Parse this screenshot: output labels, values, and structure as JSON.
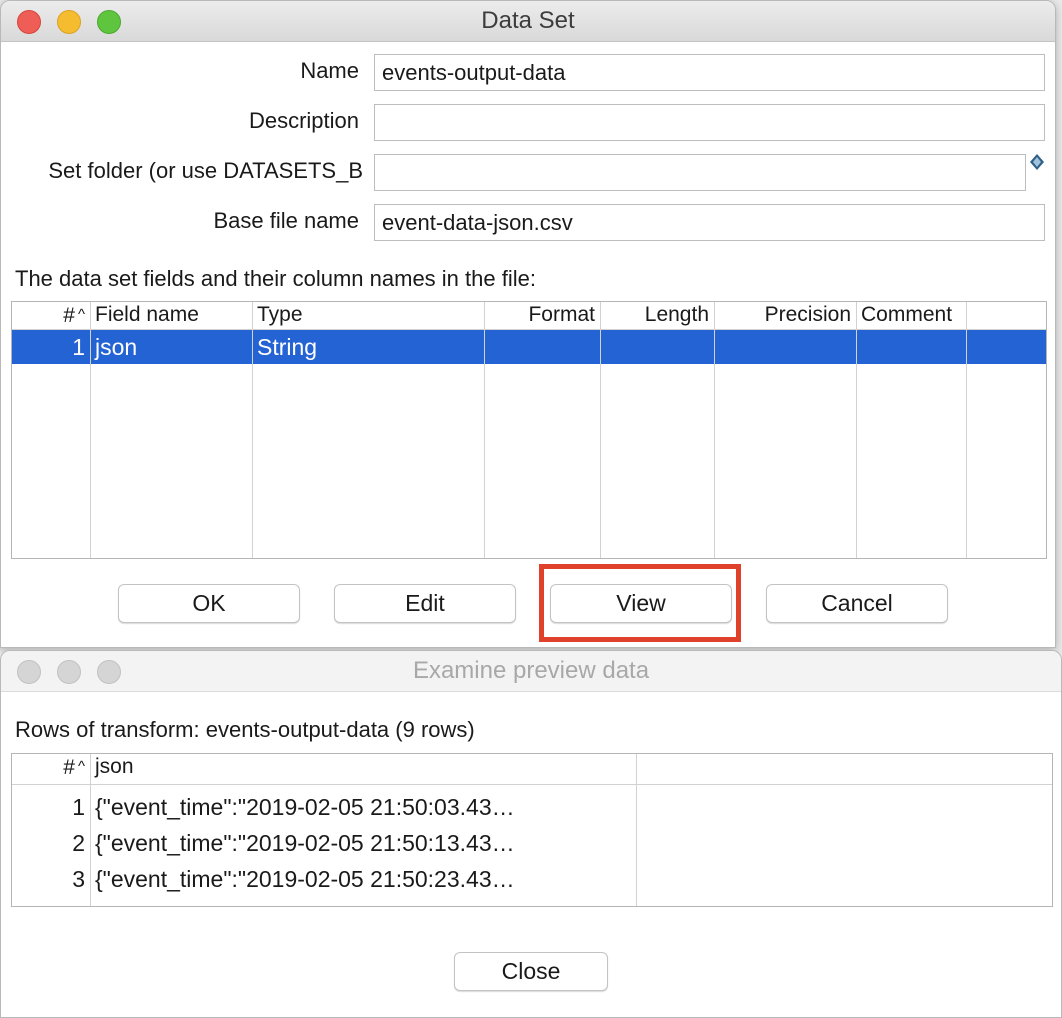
{
  "dataset_window": {
    "title": "Data Set",
    "form": {
      "name_label": "Name",
      "name_value": "events-output-data",
      "description_label": "Description",
      "description_value": "",
      "folder_label": "Set folder (or use DATASETS_B",
      "folder_value": "",
      "basefile_label": "Base file name",
      "basefile_value": "event-data-json.csv"
    },
    "fields_caption": "The data set fields and their column names in the file:",
    "fields_table": {
      "columns": [
        "#",
        "Field name",
        "Type",
        "Format",
        "Length",
        "Precision",
        "Comment"
      ],
      "sort_indicator": "^",
      "rows": [
        {
          "num": "1",
          "field": "json",
          "type": "String",
          "format": "",
          "length": "",
          "precision": "",
          "comment": ""
        }
      ],
      "selected_row": 1
    },
    "buttons": {
      "ok": "OK",
      "edit": "Edit",
      "view": "View",
      "cancel": "Cancel"
    },
    "highlight_color": "#e0412b"
  },
  "preview_window": {
    "title": "Examine preview data",
    "caption": "Rows of transform: events-output-data (9 rows)",
    "table": {
      "columns": [
        "#",
        "json"
      ],
      "sort_indicator": "^",
      "rows": [
        {
          "num": "1",
          "json": "{\"event_time\":\"2019-02-05 21:50:03.43…"
        },
        {
          "num": "2",
          "json": "{\"event_time\":\"2019-02-05 21:50:13.43…"
        },
        {
          "num": "3",
          "json": "{\"event_time\":\"2019-02-05 21:50:23.43…"
        }
      ]
    },
    "close_label": "Close"
  },
  "colors": {
    "selection": "#2463d4",
    "close_red": "#ee5e57",
    "minimize_yellow": "#f6bc30",
    "zoom_green": "#5fc53f"
  }
}
